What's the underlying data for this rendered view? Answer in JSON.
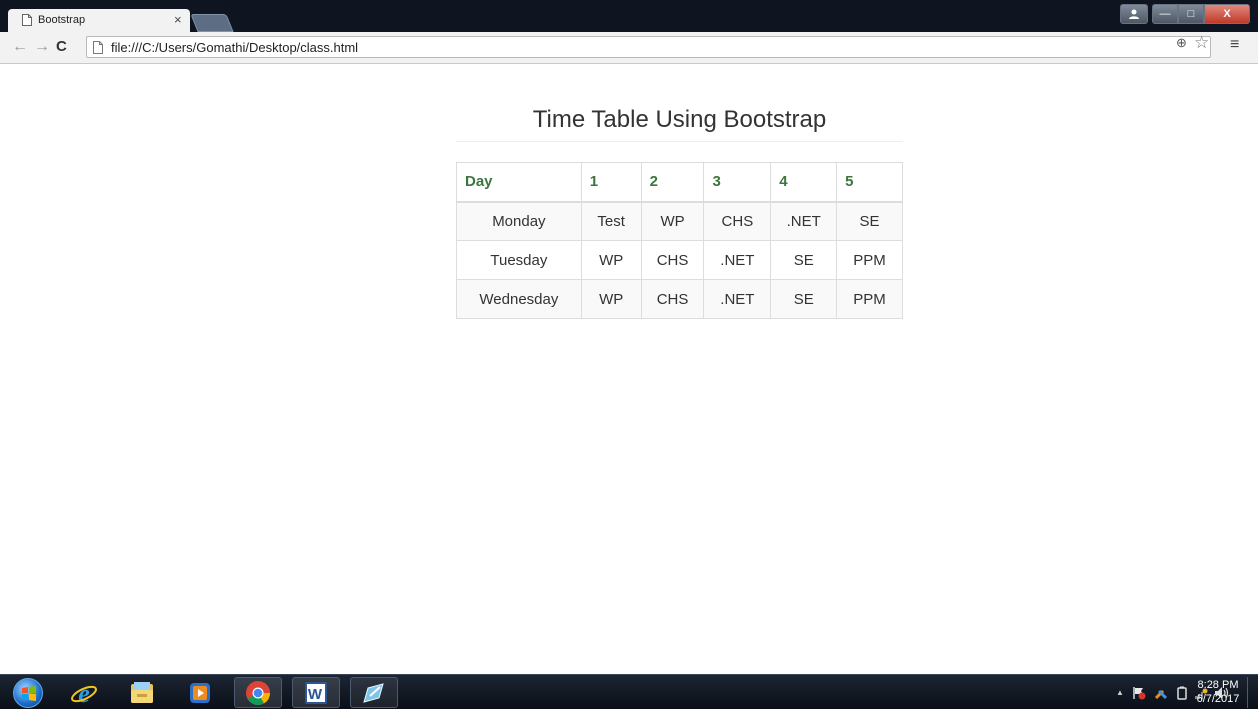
{
  "browser": {
    "tab_title": "Bootstrap",
    "tab_close": "×",
    "url": "file:///C:/Users/Gomathi/Desktop/class.html",
    "back_glyph": "←",
    "forward_glyph": "→",
    "reload_glyph": "C",
    "zoom_glyph": "⊕",
    "star_glyph": "☆",
    "menu_glyph": "≡",
    "min_glyph": "—",
    "max_glyph": "□",
    "close_glyph": "X"
  },
  "page": {
    "heading": "Time Table Using Bootstrap",
    "table": {
      "headers": [
        "Day",
        "1",
        "2",
        "3",
        "4",
        "5"
      ],
      "rows": [
        [
          "Monday",
          "Test",
          "WP",
          "CHS",
          ".NET",
          "SE"
        ],
        [
          "Tuesday",
          "WP",
          "CHS",
          ".NET",
          "SE",
          "PPM"
        ],
        [
          "Wednesday",
          "WP",
          "CHS",
          ".NET",
          "SE",
          "PPM"
        ]
      ]
    },
    "header_color": "#3c763d"
  },
  "taskbar": {
    "word_label": "W",
    "clock_time": "8:28 PM",
    "clock_date": "6/7/2017",
    "tray_arrow": "▲"
  }
}
